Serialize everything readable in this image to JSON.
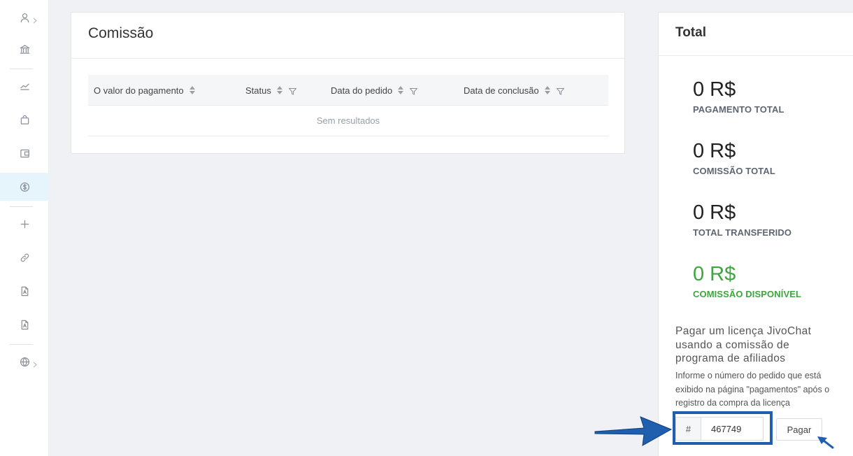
{
  "sidebar": {
    "items": [
      {
        "icon": "user-icon"
      },
      {
        "icon": "bank-icon"
      },
      {
        "icon": "chart-line-icon"
      },
      {
        "icon": "shopping-bag-icon"
      },
      {
        "icon": "wallet-icon"
      },
      {
        "icon": "dollar-circle-icon",
        "active": true
      },
      {
        "icon": "plus-icon"
      },
      {
        "icon": "link-icon"
      },
      {
        "icon": "pdf-file-icon"
      },
      {
        "icon": "pdf-file-icon-2"
      },
      {
        "icon": "globe-icon"
      }
    ]
  },
  "commission": {
    "title": "Comissão",
    "columns": [
      "O valor do pagamento",
      "Status",
      "Data do pedido",
      "Data de conclusão"
    ],
    "empty_text": "Sem resultados"
  },
  "total": {
    "title": "Total",
    "stats": [
      {
        "value": "0 R$",
        "label": "PAGAMENTO TOTAL"
      },
      {
        "value": "0 R$",
        "label": "COMISSÃO TOTAL"
      },
      {
        "value": "0 R$",
        "label": "TOTAL TRANSFERIDO"
      },
      {
        "value": "0 R$",
        "label": "COMISSÃO DISPONÍVEL",
        "color": "#3da63d"
      }
    ],
    "pay_heading": "Pagar um licença JivoChat usando a comissão de programa de afiliados",
    "pay_description": "Informe o número do pedido que está exibido na página \"pagamentos\" após o registro da compra da licença",
    "order_prefix": "#",
    "order_value": "467749",
    "pay_button": "Pagar"
  },
  "colors": {
    "accent": "#1f5fad",
    "available": "#3da63d",
    "active_nav_bg": "#e6f4fb"
  }
}
